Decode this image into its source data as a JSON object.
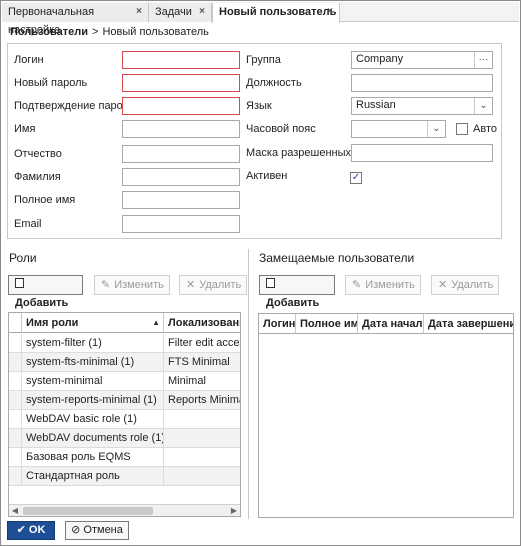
{
  "tabs": [
    {
      "label": "Первоначальная настройка",
      "close": "×"
    },
    {
      "label": "Задачи",
      "close": "×"
    },
    {
      "label": "Новый пользователь",
      "close": "×"
    }
  ],
  "breadcrumb": {
    "parent": "Пользователи",
    "separator": ">",
    "current": "Новый пользователь"
  },
  "form": {
    "left": [
      {
        "label": "Логин",
        "value": "",
        "required": true
      },
      {
        "label": "Новый пароль",
        "value": "",
        "required": true
      },
      {
        "label": "Подтверждение пароля",
        "value": "",
        "required": true
      },
      {
        "label": "Имя",
        "value": ""
      },
      {
        "label": "Отчество",
        "value": ""
      },
      {
        "label": "Фамилия",
        "value": ""
      },
      {
        "label": "Полное имя",
        "value": ""
      },
      {
        "label": "Email",
        "value": ""
      }
    ],
    "group": {
      "label": "Группа",
      "value": "Company",
      "button": "···"
    },
    "position": {
      "label": "Должность",
      "value": ""
    },
    "language": {
      "label": "Язык",
      "value": "Russian",
      "button": "⌄"
    },
    "timezone": {
      "label": "Часовой пояс",
      "value": "",
      "button": "⌄",
      "auto_label": "Авто",
      "auto_checked": false
    },
    "ip_mask": {
      "label": "Маска разрешенных IP",
      "value": ""
    },
    "active": {
      "label": "Активен",
      "checked": true,
      "mark": "✓"
    }
  },
  "roles": {
    "title": "Роли",
    "buttons": {
      "add": "Добавить",
      "edit": "Изменить",
      "delete": "Удалить"
    },
    "columns": [
      "Имя роли",
      "Локализованно"
    ],
    "sort_indicator": "▲",
    "rows": [
      {
        "name": "system-filter (1)",
        "localized": "Filter edit access"
      },
      {
        "name": "system-fts-minimal (1)",
        "localized": "FTS Minimal"
      },
      {
        "name": "system-minimal",
        "localized": "Minimal"
      },
      {
        "name": "system-reports-minimal (1)",
        "localized": "Reports Minimal"
      },
      {
        "name": "WebDAV basic role (1)",
        "localized": ""
      },
      {
        "name": "WebDAV documents role (1)",
        "localized": ""
      },
      {
        "name": "Базовая роль EQMS",
        "localized": ""
      },
      {
        "name": "Стандартная роль",
        "localized": ""
      }
    ]
  },
  "substituted": {
    "title": "Замещаемые пользователи",
    "buttons": {
      "add": "Добавить",
      "edit": "Изменить",
      "delete": "Удалить"
    },
    "columns": [
      "Логин",
      "Полное имя",
      "Дата начала",
      "Дата завершения"
    ]
  },
  "footer": {
    "ok": "OK",
    "cancel": "Отмена"
  },
  "icons": {
    "add": "add-icon",
    "edit": "pencil-icon",
    "delete": "close-icon",
    "ok": "check-icon",
    "cancel": "cancel-icon"
  },
  "colors": {
    "accent": "#1e4f95",
    "required_border": "#d94b4b"
  }
}
